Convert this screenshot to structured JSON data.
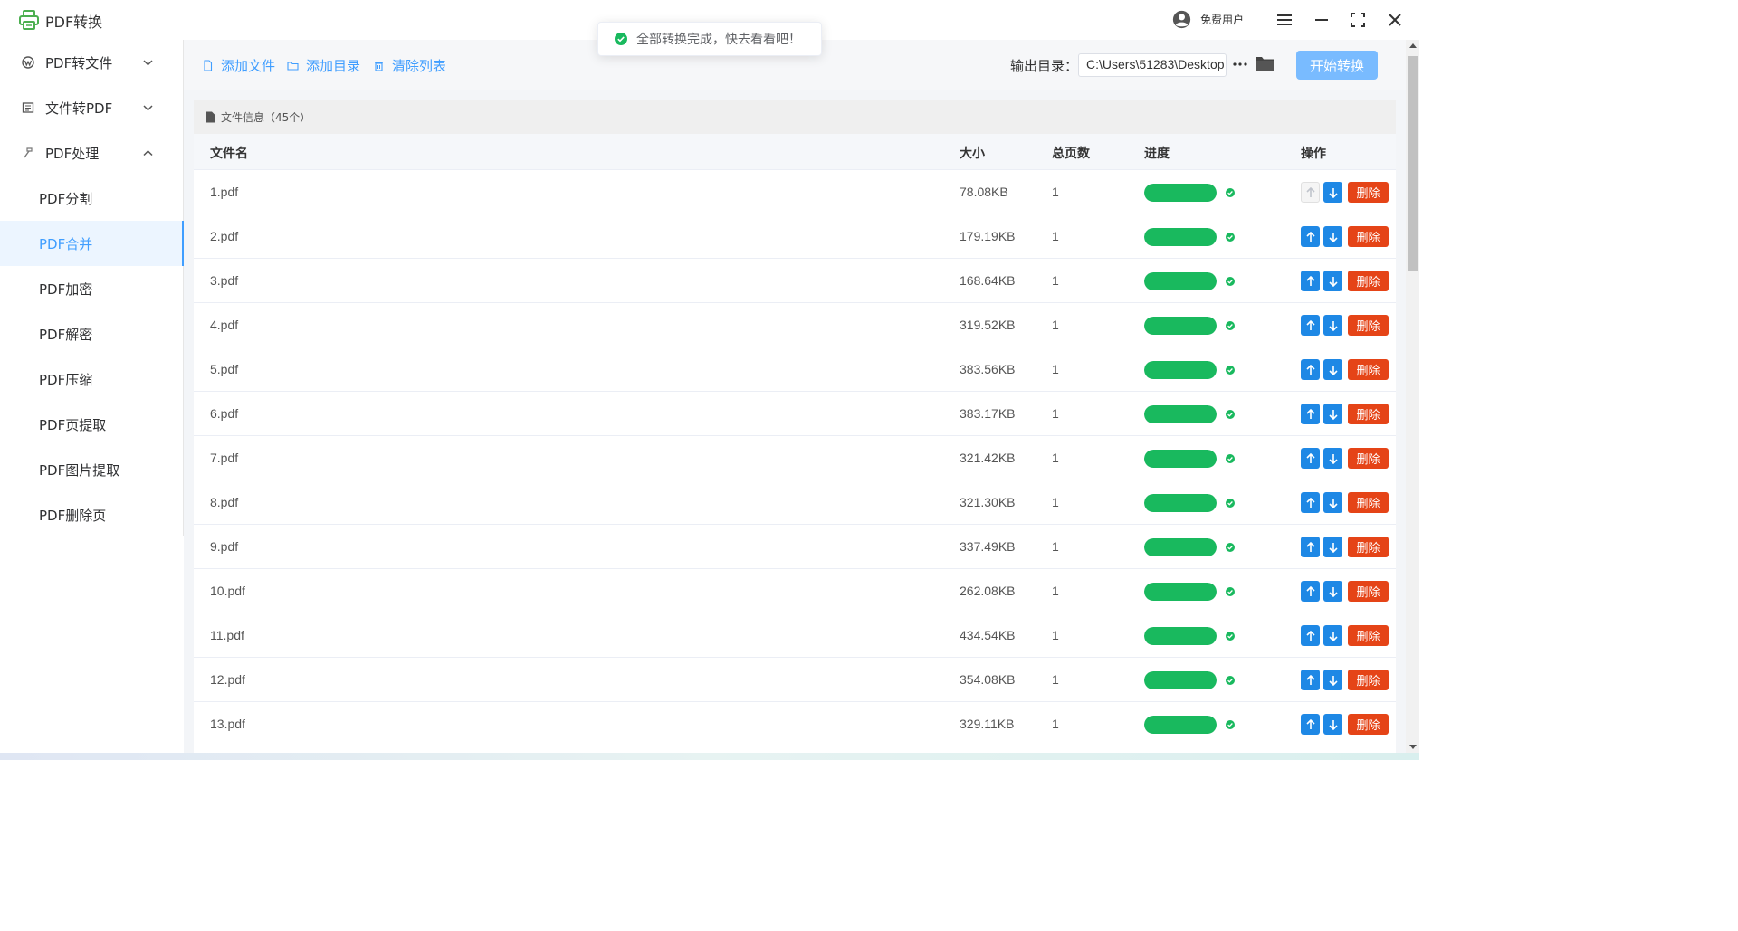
{
  "app": {
    "title": "PDF转换",
    "logo_icon": "printer-icon",
    "brand_color": "#4caf50"
  },
  "user": {
    "label": "免费用户",
    "icon": "user-circle-icon"
  },
  "window_controls": [
    "menu-icon",
    "minimize-icon",
    "fullscreen-icon",
    "close-icon"
  ],
  "toast": {
    "message": "全部转换完成，快去看看吧！",
    "icon": "check-circle-icon",
    "color": "#19b95e"
  },
  "sidebar": {
    "groups": [
      {
        "label": "PDF转文件",
        "icon": "wordpress-icon",
        "expanded": false
      },
      {
        "label": "文件转PDF",
        "icon": "document-icon",
        "expanded": false
      },
      {
        "label": "PDF处理",
        "icon": "hammer-icon",
        "expanded": true
      }
    ],
    "sub_items": [
      {
        "label": "PDF分割",
        "active": false
      },
      {
        "label": "PDF合并",
        "active": true
      },
      {
        "label": "PDF加密",
        "active": false
      },
      {
        "label": "PDF解密",
        "active": false
      },
      {
        "label": "PDF压缩",
        "active": false
      },
      {
        "label": "PDF页提取",
        "active": false
      },
      {
        "label": "PDF图片提取",
        "active": false
      },
      {
        "label": "PDF删除页",
        "active": false
      }
    ],
    "accent": "#409eff"
  },
  "toolbar": {
    "add_file": "添加文件",
    "add_dir": "添加目录",
    "clear_list": "清除列表",
    "output_label": "输出目录：",
    "output_path": "C:\\Users\\51283\\Desktop",
    "more_label": "···",
    "start_label": "开始转换"
  },
  "panel": {
    "title": "文件信息（45个）"
  },
  "table": {
    "columns": {
      "name": "文件名",
      "size": "大小",
      "pages": "总页数",
      "progress": "进度",
      "actions": "操作"
    },
    "delete_label": "删除",
    "rows": [
      {
        "name": "1.pdf",
        "size": "78.08KB",
        "pages": "1",
        "progress": 1.0,
        "up_enabled": false
      },
      {
        "name": "2.pdf",
        "size": "179.19KB",
        "pages": "1",
        "progress": 1.0,
        "up_enabled": true
      },
      {
        "name": "3.pdf",
        "size": "168.64KB",
        "pages": "1",
        "progress": 1.0,
        "up_enabled": true
      },
      {
        "name": "4.pdf",
        "size": "319.52KB",
        "pages": "1",
        "progress": 1.0,
        "up_enabled": true
      },
      {
        "name": "5.pdf",
        "size": "383.56KB",
        "pages": "1",
        "progress": 1.0,
        "up_enabled": true
      },
      {
        "name": "6.pdf",
        "size": "383.17KB",
        "pages": "1",
        "progress": 1.0,
        "up_enabled": true
      },
      {
        "name": "7.pdf",
        "size": "321.42KB",
        "pages": "1",
        "progress": 1.0,
        "up_enabled": true
      },
      {
        "name": "8.pdf",
        "size": "321.30KB",
        "pages": "1",
        "progress": 1.0,
        "up_enabled": true
      },
      {
        "name": "9.pdf",
        "size": "337.49KB",
        "pages": "1",
        "progress": 1.0,
        "up_enabled": true
      },
      {
        "name": "10.pdf",
        "size": "262.08KB",
        "pages": "1",
        "progress": 1.0,
        "up_enabled": true
      },
      {
        "name": "11.pdf",
        "size": "434.54KB",
        "pages": "1",
        "progress": 1.0,
        "up_enabled": true
      },
      {
        "name": "12.pdf",
        "size": "354.08KB",
        "pages": "1",
        "progress": 1.0,
        "up_enabled": true
      },
      {
        "name": "13.pdf",
        "size": "329.11KB",
        "pages": "1",
        "progress": 1.0,
        "up_enabled": true
      }
    ],
    "progress_color": "#19b95e",
    "move_button_color": "#1e88e5",
    "delete_button_color": "#e54417"
  }
}
